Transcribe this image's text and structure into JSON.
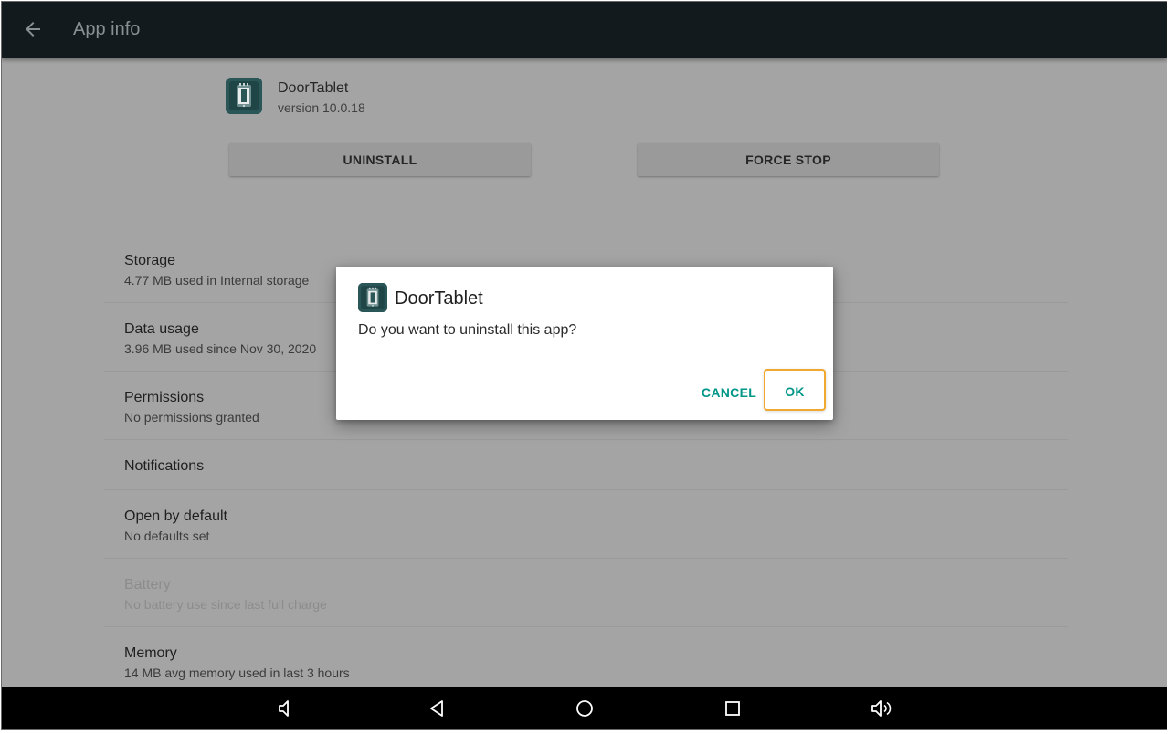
{
  "appbar": {
    "title": "App info",
    "back_icon": "arrow-left-icon"
  },
  "app": {
    "name": "DoorTablet",
    "version": "version 10.0.18",
    "icon": "doortablet-app-icon"
  },
  "actions": {
    "uninstall_label": "UNINSTALL",
    "force_stop_label": "FORCE STOP"
  },
  "settings": {
    "items": [
      {
        "title": "Storage",
        "subtitle": "4.77 MB used in Internal storage"
      },
      {
        "title": "Data usage",
        "subtitle": "3.96 MB used since Nov 30, 2020"
      },
      {
        "title": "Permissions",
        "subtitle": "No permissions granted"
      },
      {
        "title": "Notifications",
        "subtitle": ""
      },
      {
        "title": "Open by default",
        "subtitle": "No defaults set"
      },
      {
        "title": "Battery",
        "subtitle": "No battery use since last full charge"
      },
      {
        "title": "Memory",
        "subtitle": "14 MB avg memory used in last 3 hours"
      }
    ]
  },
  "dialog": {
    "title": "DoorTablet",
    "message": "Do you want to uninstall this app?",
    "cancel_label": "CANCEL",
    "ok_label": "OK"
  },
  "navbar": {
    "icons": [
      "volume-down-icon",
      "back-triangle-icon",
      "home-circle-icon",
      "recents-square-icon",
      "volume-up-icon"
    ]
  },
  "colors": {
    "appbar_bg": "#131a1d",
    "accent": "#009688",
    "highlight": "#f0a830",
    "scrim_bg": "#a4a4a4"
  }
}
